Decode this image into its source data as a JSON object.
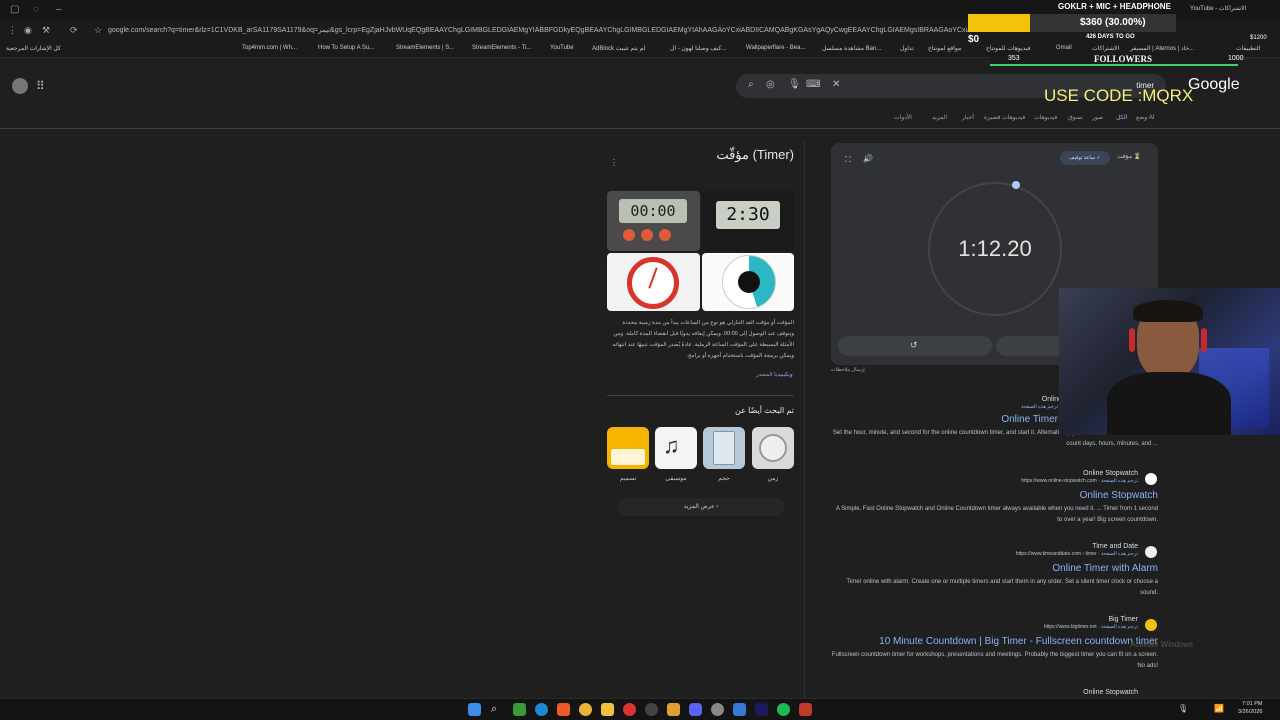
{
  "browser": {
    "url": "google.com/search?q=timer&rlz=1C1VDKB_arSA1179SA1179&oq=تيمر&gs_lcrp=EgZjaHJvbWUqEQgBEAAYChgLGIMBGLEDGIAEMgYIABBFGDkyEQgBEAAYChgLGIMBGLEDGIAEMgYIAhAAGAoYCxiABDIICAMQABgKGAsYgAQyCwgEEAAYChgLGIAEMgsIBRAAGAoYCxiABDIL",
    "bookmarks": [
      "كل الإشارات المرجعية",
      "Top4mm.com | Wh...",
      "How To Setup A Su...",
      "StreamElements | S...",
      "StreamElements - Ti...",
      "YouTube",
      "AdBlock لم يتم تثبيت",
      "كيف وصلنا لهون - ال...",
      "Wallpaperflare - Bea...",
      "مشاهدة مسلسل Ban...",
      "تداول",
      "مواقع لمونتاج",
      "فيديوهات للمونتاج",
      "Gmail",
      "الاشتراكات",
      "المسيقر | Aternos | خاد...",
      "التطبيقات"
    ]
  },
  "search": {
    "query": "timer",
    "logo": "Google",
    "tabs": [
      "وضع AI",
      "الكل",
      "صور",
      "تسوق",
      "فيديوهات",
      "فيديوهات قصيرة",
      "أخبار",
      "المزيد",
      "الأدوات"
    ]
  },
  "timer_widget": {
    "time": "1:12.20",
    "mode_stopwatch": "ساعة توقيف",
    "mode_timer": "مؤقت",
    "feedback": "إرسال ملاحظات"
  },
  "knowledge_panel": {
    "title": "مؤقّت (Timer)",
    "description": "المؤقت أو مؤقت العد التنازلي هو نوع من الساعات يبدأ من مدة زمنية محددة ويتوقف عند الوصول إلى 00:00. ويمكن إيقافه يدويًا قبل انقضاء المدة كاملة. ومن الأمثلة البسيطة على المؤقت الساعة الرملية. عادةً يُصدر المؤقت تنبيهًا عند انتهائه. ويمكن برمجة المؤقت باستخدام أجهزة أو برامج.",
    "source_label": "المصدر:",
    "source": "ويكيبيديا",
    "also_searched": "تم البحث أيضًا عن",
    "related": [
      "زمن",
      "حجم",
      "موسيقى",
      "تسميم"
    ],
    "show_more": "عرض المزيد",
    "image_digits": [
      "00:00",
      "2:30"
    ]
  },
  "results": [
    {
      "site": "Online",
      "url": "",
      "title": "Online Timer",
      "snippet": "Set the hour, minute, and second for the online countdown timer, and start it. Alternatively, you can set the date and time to count days, hours, minutes, and ..."
    },
    {
      "site": "Online Stopwatch",
      "url": "https://www.online-stopwatch.com",
      "title": "Online Stopwatch",
      "snippet": "A Simple, Fast Online Stopwatch and Online Countdown timer always available when you need it. ... Timer from 1 second to over a year! Big screen countdown."
    },
    {
      "site": "Time and Date",
      "url": "https://www.timeanddate.com › timer",
      "title": "Online Timer with Alarm",
      "snippet": "Timer online with alarm. Create one or multiple timers and start them in any order. Set a silent timer clock or choose a sound."
    },
    {
      "site": "Big Timer",
      "url": "https://www.bigtimer.net",
      "title": "10 Minute Countdown | Big Timer - Fullscreen countdown timer",
      "snippet": "Fullscreen countdown timer for workshops, presentations and meetings. Probably the biggest timer you can fit on a screen. No ads!"
    },
    {
      "site": "Online Stopwatch",
      "url": "",
      "title": "",
      "snippet": ""
    }
  ],
  "translate_label": "ترجم هذه الصفحة",
  "overlay": {
    "name": "GOKLR + MIC + HEADPHONE",
    "progress_fraction": 0.3,
    "progress_text": "$360 (30.00%)",
    "start": "$0",
    "goal": "$1200",
    "days": "426 DAYS TO GO",
    "followers_left": "353",
    "followers_label": "FOLLOWERS",
    "followers_right": "1000",
    "code": "USE CODE :MQRX",
    "watermark": "Activate Windows"
  },
  "taskbar": {
    "time": "7:01 PM",
    "date": "3/26/2026"
  },
  "colors": {
    "accent": "#8ab4f8",
    "bg": "#1f1f1f",
    "card": "#303134",
    "goal_fill": "#f4c20d",
    "follow_bar": "#3cd070"
  }
}
